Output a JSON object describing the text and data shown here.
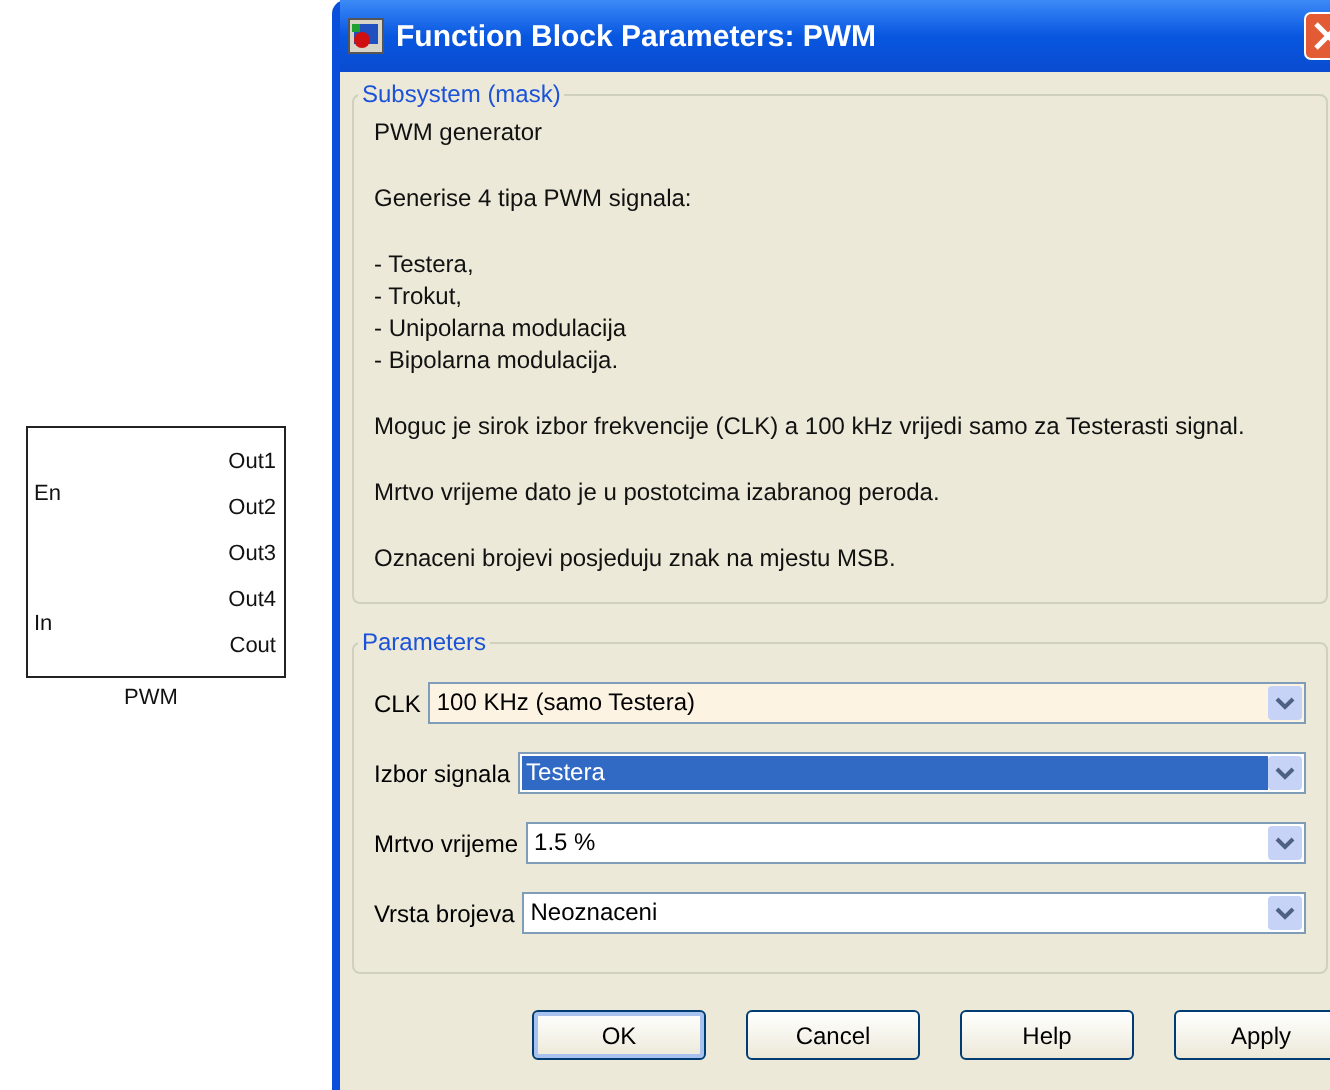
{
  "block": {
    "name": "PWM",
    "inputs": [
      "En",
      "In"
    ],
    "outputs": [
      "Out1",
      "Out2",
      "Out3",
      "Out4",
      "Cout"
    ]
  },
  "window": {
    "title": "Function Block Parameters: PWM"
  },
  "description": {
    "title": "Subsystem (mask)",
    "paragraphs": [
      [
        "PWM generator"
      ],
      [
        "Generise 4 tipa PWM signala:"
      ],
      [
        "- Testera,",
        "- Trokut,",
        "- Unipolarna modulacija",
        "- Bipolarna modulacija."
      ],
      [
        "Moguc je sirok izbor frekvencije (CLK) a 100 kHz vrijedi samo za Testerasti signal."
      ],
      [
        "Mrtvo vrijeme dato je u postotcima izabranog peroda."
      ],
      [
        "Oznaceni brojevi posjeduju znak na mjestu MSB."
      ]
    ]
  },
  "parameters": {
    "title": "Parameters",
    "fields": [
      {
        "label": "CLK",
        "value": "100 KHz (samo Testera)",
        "hovered": true,
        "selected": false
      },
      {
        "label": "Izbor signala",
        "value": "Testera",
        "hovered": false,
        "selected": true
      },
      {
        "label": "Mrtvo vrijeme",
        "value": "1.5 %",
        "hovered": false,
        "selected": false
      },
      {
        "label": "Vrsta brojeva",
        "value": "Neoznaceni",
        "hovered": false,
        "selected": false
      }
    ]
  },
  "buttons": [
    {
      "label": "OK",
      "default": true
    },
    {
      "label": "Cancel",
      "default": false
    },
    {
      "label": "Help",
      "default": false
    },
    {
      "label": "Apply",
      "default": false
    }
  ]
}
